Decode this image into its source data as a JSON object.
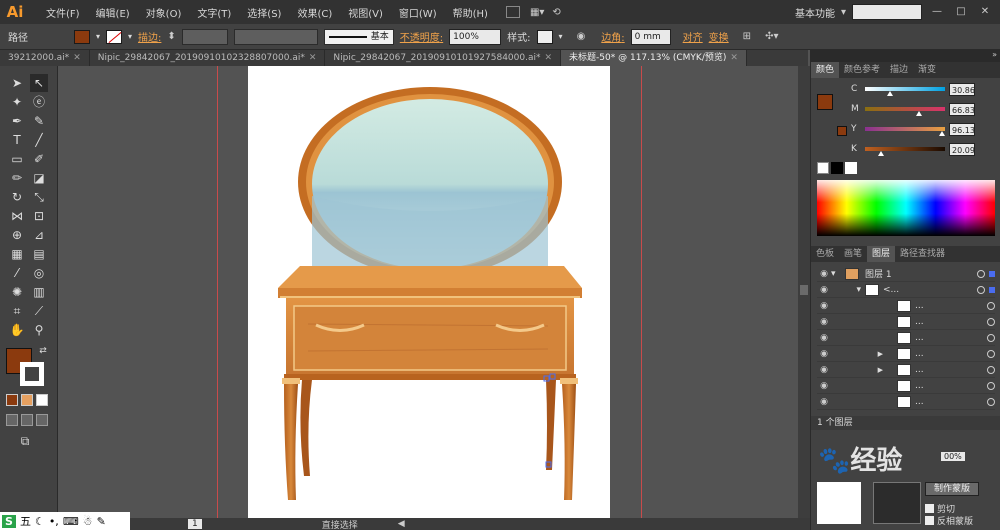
{
  "app": {
    "logo": "Ai",
    "menus": [
      "文件(F)",
      "编辑(E)",
      "对象(O)",
      "文字(T)",
      "选择(S)",
      "效果(C)",
      "视图(V)",
      "窗口(W)",
      "帮助(H)"
    ],
    "workspace": "基本功能",
    "search_placeholder": ""
  },
  "control_bar": {
    "mode_label": "路径",
    "stroke_label": "描边",
    "stroke_style": "基本",
    "opacity_label": "不透明度",
    "opacity_value": "100%",
    "style_label": "样式",
    "corner_label": "边角",
    "corner_value": "0 mm",
    "align_label": "对齐",
    "transform_label": "变换",
    "fill_color": "#8b3a0e"
  },
  "tabs": [
    {
      "label": "39212000.ai*",
      "active": false
    },
    {
      "label": "Nipic_29842067_20190910102328807000.ai*",
      "active": false
    },
    {
      "label": "Nipic_29842067_20190910101927584000.ai*",
      "active": false
    },
    {
      "label": "未标题-50* @ 117.13% (CMYK/预览)",
      "active": true
    }
  ],
  "status": {
    "zoom": "117.13%",
    "page": "1",
    "tool": "直接选择"
  },
  "color_panel": {
    "tabs": [
      "颜色",
      "颜色参考",
      "描边",
      "渐变"
    ],
    "channels": [
      {
        "name": "C",
        "value": "30.86",
        "pos": 0.31,
        "from": "#ffffff",
        "to": "#00a0e0"
      },
      {
        "name": "M",
        "value": "66.83",
        "pos": 0.67,
        "from": "#8a6f10",
        "to": "#d8336b"
      },
      {
        "name": "Y",
        "value": "96.13",
        "pos": 0.96,
        "from": "#8a3090",
        "to": "#e8a040"
      },
      {
        "name": "K",
        "value": "20.09",
        "pos": 0.2,
        "from": "#c06020",
        "to": "#1a0a00"
      }
    ]
  },
  "layers_panel": {
    "tabs": [
      "色板",
      "画笔",
      "图层",
      "路径查找器"
    ],
    "layer_name": "图层 1",
    "group_name": "<...",
    "sub_items": [
      "...",
      "...",
      "...",
      "...",
      "...",
      "...",
      "..."
    ],
    "footer": "1 个图层"
  },
  "bottom_panel": {
    "button": "制作蒙版",
    "clip_label": "剪切",
    "invert_label": "反相蒙版",
    "opacity_value": "00%"
  },
  "watermark": "经验",
  "taskbar": [
    "S",
    "五"
  ],
  "colors": {
    "accent": "#f79a2d",
    "wood_dark": "#a8501a",
    "wood": "#d9873a",
    "wood_light": "#e89b48",
    "mirror_top": "#cfe8e3",
    "mirror_bottom": "#8fbcd0",
    "guide": "#c84b4b"
  }
}
